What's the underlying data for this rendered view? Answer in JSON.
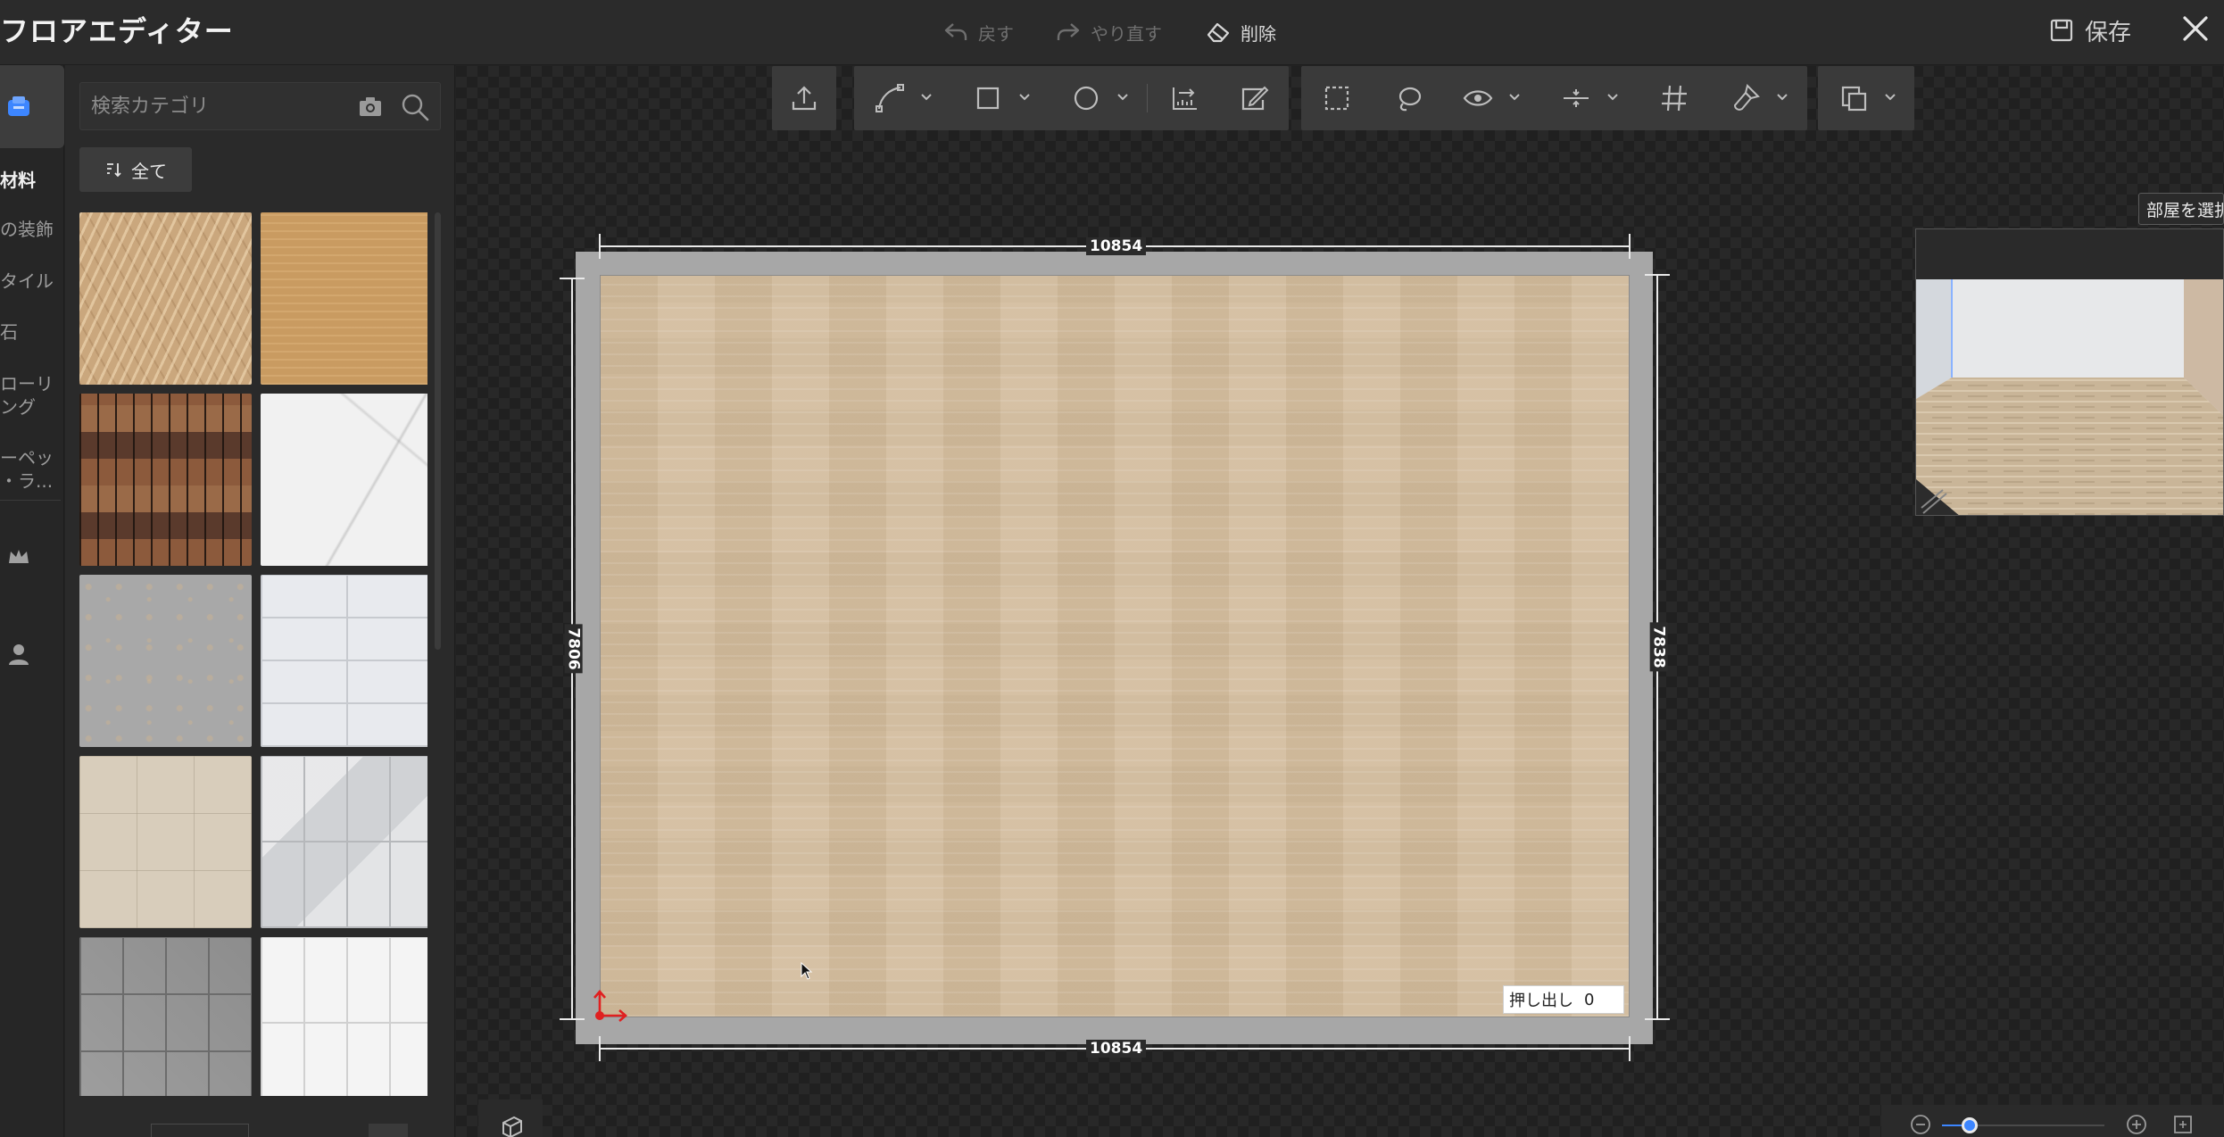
{
  "app": {
    "title": "フロアエディター",
    "undo_label": "戻す",
    "redo_label": "やり直す",
    "delete_label": "削除",
    "save_label": "保存"
  },
  "sidebar": {
    "categories": [
      {
        "label": "材料",
        "selected": true
      },
      {
        "label": "の装飾",
        "selected": false
      },
      {
        "label": "タイル",
        "selected": false
      },
      {
        "label": "石",
        "selected": false
      },
      {
        "label": "ローリ",
        "selected": false
      },
      {
        "label": "ング",
        "selected": false
      },
      {
        "label": "ーペッ",
        "selected": false
      },
      {
        "label": "・ラ...",
        "selected": false
      }
    ],
    "icons": [
      "material-icon",
      "crown-icon",
      "user-icon"
    ]
  },
  "panel": {
    "search_placeholder": "検索カテゴリ",
    "filter_label": "全て",
    "materials": [
      {
        "name": "tropical-leaf-pattern",
        "color": "#c9a57a"
      },
      {
        "name": "light-oak-wood",
        "color": "#c89a5f"
      },
      {
        "name": "rustic-brick",
        "color": "#7b4e34"
      },
      {
        "name": "white-marble",
        "color": "#f0f0f0"
      },
      {
        "name": "grey-terrazzo",
        "color": "#a9a9a9"
      },
      {
        "name": "white-square-tile",
        "color": "#e8eaee"
      },
      {
        "name": "beige-square-tile",
        "color": "#d6ccbb"
      },
      {
        "name": "grey-marble-tile",
        "color": "#cfd1d4"
      },
      {
        "name": "dark-grey-stone-tile",
        "color": "#8c8c8c"
      },
      {
        "name": "white-ceramic-tile",
        "color": "#f3f3f3"
      }
    ]
  },
  "toolbar": {
    "tools": [
      "upload-icon",
      "pen-curve-icon",
      "rectangle-icon",
      "circle-icon",
      "ruler-icon",
      "edit-area-icon",
      "select-region-icon",
      "lasso-icon",
      "eye-icon",
      "align-icon",
      "grid-icon",
      "paint-brush-icon",
      "copy-icon"
    ]
  },
  "plan": {
    "dim_top": "10854",
    "dim_bottom": "10854",
    "dim_left": "7806",
    "dim_right": "7838",
    "extrude_label": "押し出し",
    "extrude_value": "0"
  },
  "preview": {
    "select_room_label": "部屋を選択"
  },
  "zoom": {
    "level": 0.17
  },
  "colors": {
    "accent": "#3d86ff",
    "floor": "#d3bd9f",
    "wall": "#a7a7a7",
    "axis": "#e02020"
  }
}
